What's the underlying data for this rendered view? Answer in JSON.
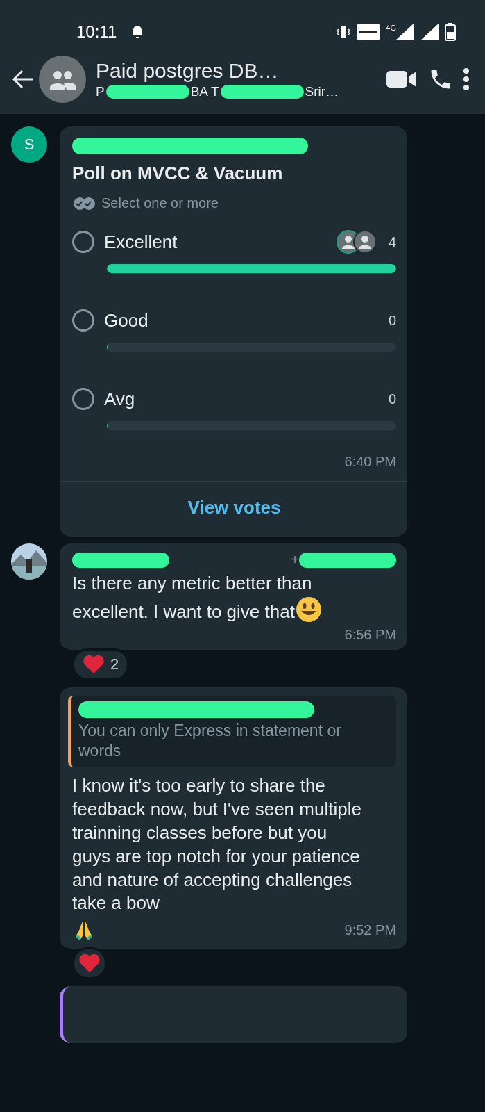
{
  "status_bar": {
    "time": "10:11",
    "network": "4G"
  },
  "header": {
    "title": "Paid postgres DB…",
    "subtitle_parts": [
      "P",
      "BA T",
      "Srir…"
    ]
  },
  "messages": [
    {
      "kind": "poll",
      "avatar_letter": "S",
      "question": "Poll on MVCC & Vacuum",
      "hint": "Select one or more",
      "options": [
        {
          "label": "Excellent",
          "selected": false,
          "count": "4",
          "level": 1,
          "voters": true
        },
        {
          "label": "Good",
          "selected": false,
          "count": "0",
          "level": 0,
          "voters": false
        },
        {
          "label": "Avg",
          "selected": false,
          "count": "0",
          "level": 0,
          "voters": false
        }
      ],
      "time": "6:40 PM",
      "action": "View votes"
    },
    {
      "kind": "text",
      "sender_fragment": "+",
      "text": "Is there any metric better than excellent. I want to give that",
      "smiley": true,
      "time": "6:56 PM",
      "reaction_count": "2"
    },
    {
      "kind": "reply",
      "quote": "You can only Express in statement or words",
      "text": "I know it's too early to share the feedback now, but I've seen multiple trainning classes before but you guys are top notch for your patience and nature of accepting challenges take a bow",
      "praying_hands": true,
      "time": "9:52 PM"
    }
  ]
}
